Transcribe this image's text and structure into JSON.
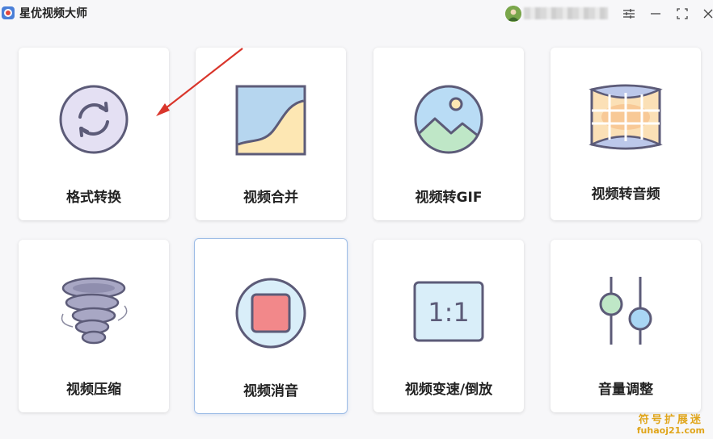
{
  "app": {
    "title": "星优视频大师"
  },
  "user": {
    "name": ""
  },
  "tools": [
    {
      "label": "格式转换"
    },
    {
      "label": "视频合并"
    },
    {
      "label": "视频转GIF"
    },
    {
      "label": "视频转音频"
    },
    {
      "label": "视频压缩"
    },
    {
      "label": "视频消音"
    },
    {
      "label": "视频变速/倒放"
    },
    {
      "label": "音量调整"
    }
  ],
  "watermark": {
    "line1": "符号扩展迷",
    "line2": "fuhaoj21.com"
  },
  "colors": {
    "accent": "#4a7fd8",
    "active_border": "#9dbce6",
    "arrow": "#d9352b",
    "watermark": "#e0a51a"
  }
}
